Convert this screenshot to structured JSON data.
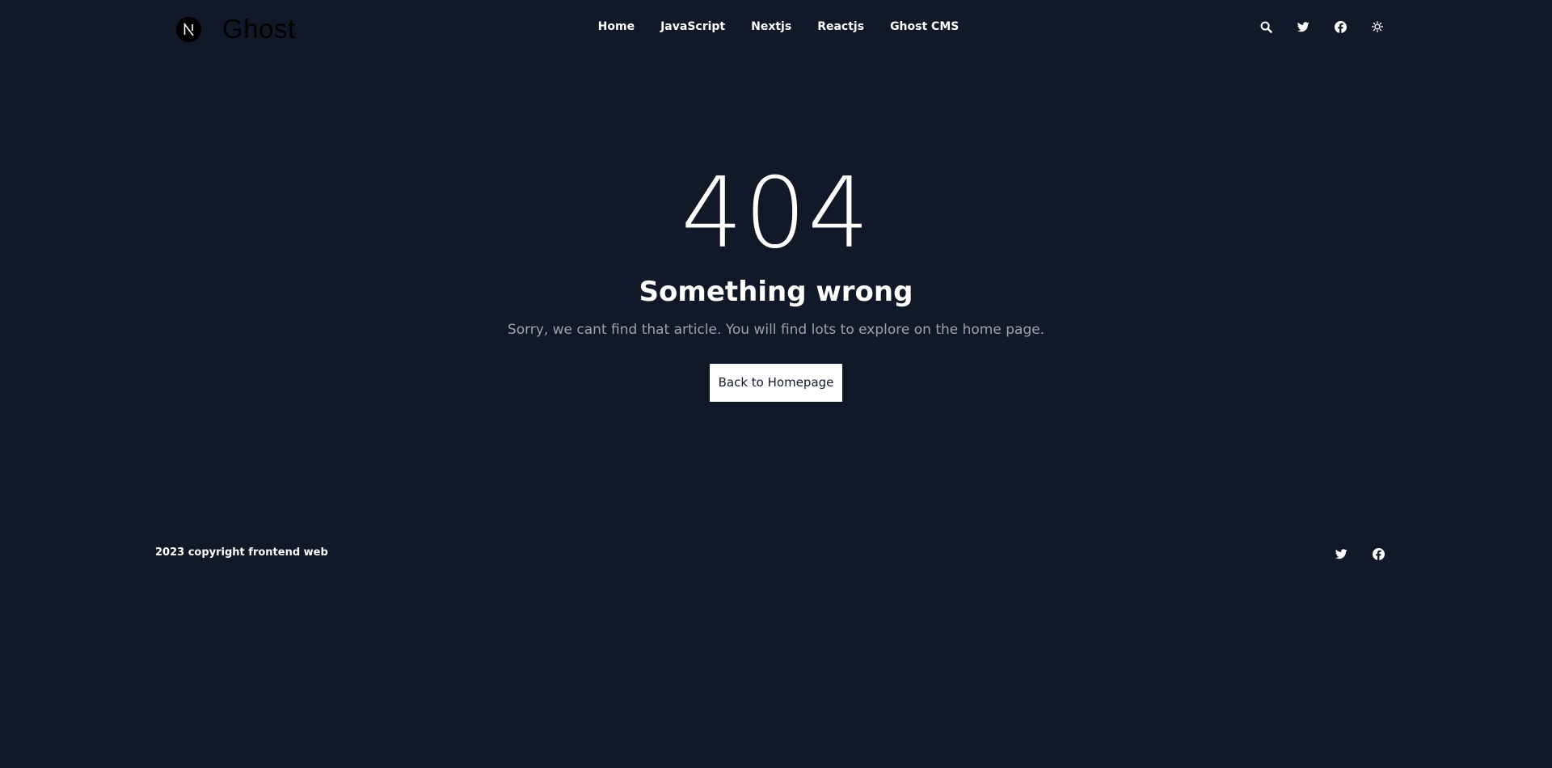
{
  "header": {
    "logo": {
      "icon": "nextjs-logo-icon",
      "text": "Ghost"
    },
    "nav": [
      {
        "label": "Home"
      },
      {
        "label": "JavaScript"
      },
      {
        "label": "Nextjs"
      },
      {
        "label": "Reactjs"
      },
      {
        "label": "Ghost CMS"
      }
    ],
    "icons": [
      "search-icon",
      "twitter-icon",
      "facebook-icon",
      "theme-toggle-icon"
    ]
  },
  "main": {
    "code": "404",
    "heading": "Something wrong",
    "message": "Sorry, we cant find that article. You will find lots to explore on the home page.",
    "button_label": "Back to Homepage"
  },
  "footer": {
    "copyright": "2023 copyright frontend web",
    "icons": [
      "twitter-icon",
      "facebook-icon"
    ]
  },
  "colors": {
    "background": "#111827",
    "text": "#ffffff",
    "muted_text": "#9ca3af",
    "button_bg": "#ffffff"
  }
}
